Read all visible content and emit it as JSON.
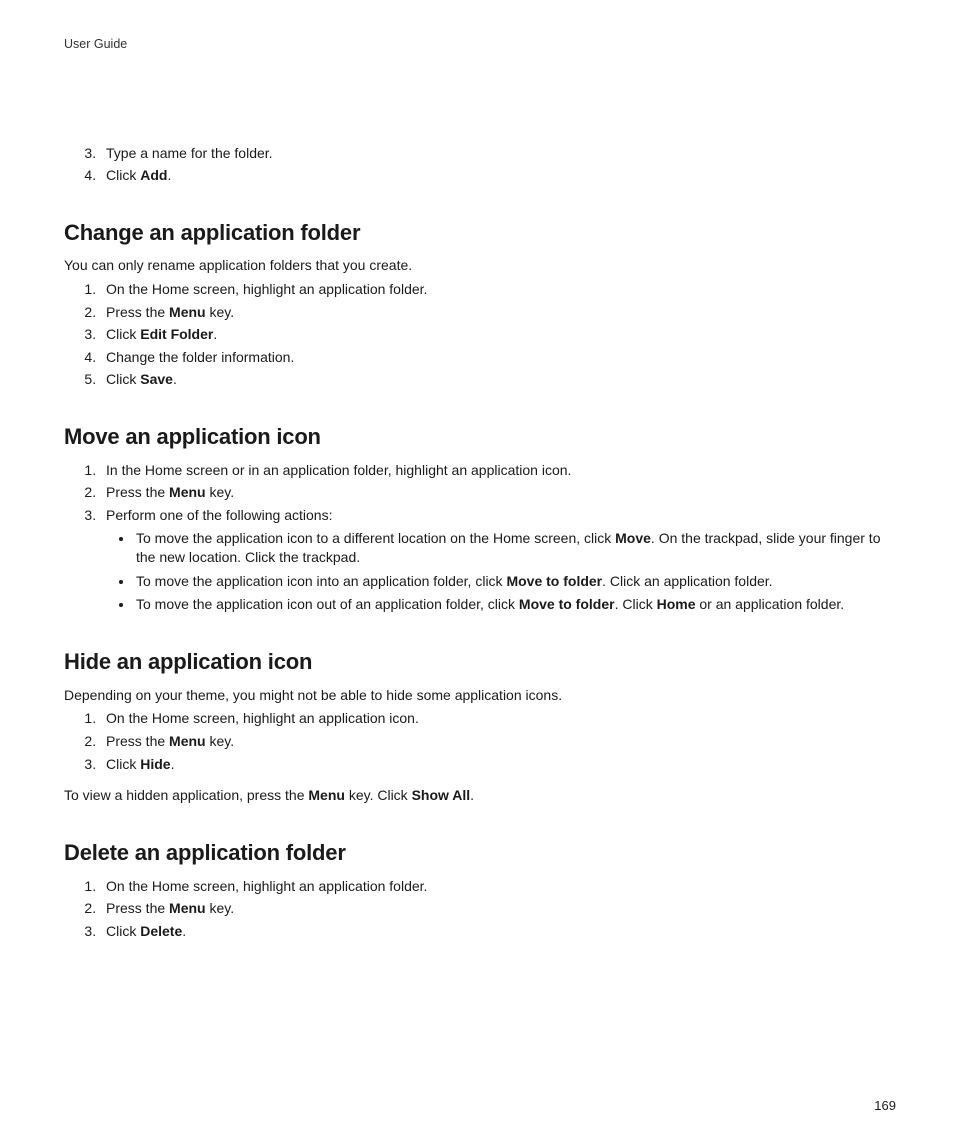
{
  "header": {
    "title": "User Guide"
  },
  "pageNumber": "169",
  "topList": {
    "startNum": "3",
    "items": [
      {
        "parts": [
          "Type a name for the folder."
        ]
      },
      {
        "parts": [
          "Click ",
          "Add",
          "."
        ]
      }
    ]
  },
  "sections": {
    "change": {
      "title": "Change an application folder",
      "intro": "You can only rename application folders that you create.",
      "steps": [
        {
          "parts": [
            "On the Home screen, highlight an application folder."
          ]
        },
        {
          "parts": [
            "Press the ",
            "Menu",
            " key."
          ]
        },
        {
          "parts": [
            "Click ",
            "Edit Folder",
            "."
          ]
        },
        {
          "parts": [
            "Change the folder information."
          ]
        },
        {
          "parts": [
            "Click ",
            "Save",
            "."
          ]
        }
      ]
    },
    "move": {
      "title": "Move an application icon",
      "steps": [
        {
          "parts": [
            "In the Home screen or in an application folder, highlight an application icon."
          ]
        },
        {
          "parts": [
            "Press the ",
            "Menu",
            " key."
          ]
        },
        {
          "parts": [
            "Perform one of the following actions:"
          ],
          "bullets": [
            {
              "parts": [
                "To move the application icon to a different location on the Home screen, click ",
                "Move",
                ". On the trackpad, slide your finger to the new location. Click the trackpad."
              ]
            },
            {
              "parts": [
                "To move the application icon into an application folder, click ",
                "Move to folder",
                ". Click an application folder."
              ]
            },
            {
              "parts": [
                "To move the application icon out of an application folder, click ",
                "Move to folder",
                ". Click ",
                "Home",
                " or an application folder."
              ]
            }
          ]
        }
      ]
    },
    "hide": {
      "title": "Hide an application icon",
      "intro": "Depending on your theme, you might not be able to hide some application icons.",
      "steps": [
        {
          "parts": [
            "On the Home screen, highlight an application icon."
          ]
        },
        {
          "parts": [
            "Press the ",
            "Menu",
            " key."
          ]
        },
        {
          "parts": [
            "Click ",
            "Hide",
            "."
          ]
        }
      ],
      "note": {
        "parts": [
          "To view a hidden application, press the ",
          "Menu",
          " key. Click ",
          "Show All",
          "."
        ]
      }
    },
    "del": {
      "title": "Delete an application folder",
      "steps": [
        {
          "parts": [
            "On the Home screen, highlight an application folder."
          ]
        },
        {
          "parts": [
            "Press the ",
            "Menu",
            " key."
          ]
        },
        {
          "parts": [
            "Click ",
            "Delete",
            "."
          ]
        }
      ]
    }
  }
}
